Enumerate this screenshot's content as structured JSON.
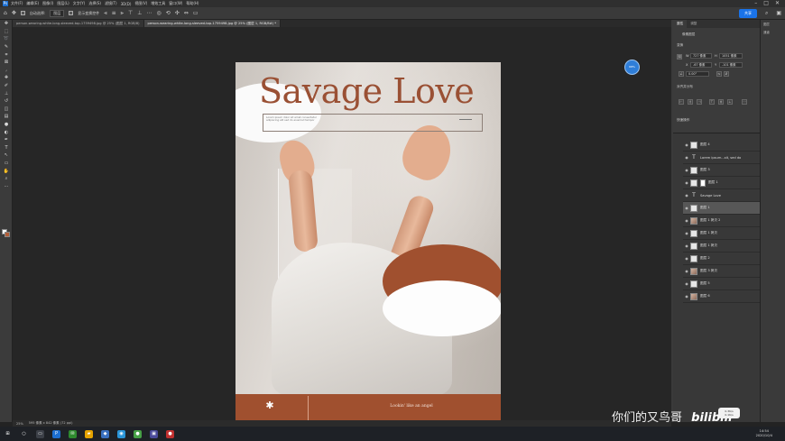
{
  "menubar": {
    "items": [
      "文件(F)",
      "编辑(E)",
      "图像(I)",
      "图层(L)",
      "文字(Y)",
      "选择(S)",
      "滤镜(T)",
      "3D(D)",
      "视图(V)",
      "增效工具",
      "窗口(W)",
      "帮助(H)"
    ],
    "ps_label": "Ps"
  },
  "options": {
    "auto_select": "自动选择:",
    "auto_select_target": "图层",
    "transform_controls": "显示变换控件",
    "share": "共享"
  },
  "tabs": [
    {
      "label": "person-wearing-white-long-sleeved-top-1759498.jpg @ 25% (图层 1, RGB/8)",
      "active": false
    },
    {
      "label": "person-wearing-white-long-sleeved-top-1759498.jpg @ 25% (图层 1, RGB/8#) *",
      "active": true
    }
  ],
  "document": {
    "title": "Savage Love",
    "subtitle_lines": [
      "Lorem ipsum dolor sit amet consectetur",
      "adipiscing elit sed do eiusmod tempor"
    ],
    "footer_star": "✱",
    "footer_text": "Lookin' like an angel"
  },
  "float_icon_label": "68%",
  "statusbar": {
    "zoom": "25%",
    "doc_info": "595 像素 x 842 像素 (72 ppi)"
  },
  "properties": {
    "tabs": [
      "属性",
      "调整"
    ],
    "section_title": "像素图层",
    "transform_label": "变换",
    "w_label": "W",
    "w_value": "727 像素",
    "h_label": "H",
    "h_value": "1051 像素",
    "x_label": "X",
    "x_value": "-67 像素",
    "y_label": "Y",
    "y_value": "-101 像素",
    "angle": "0.00°",
    "align_label": "对齐并分布",
    "quick_label": "快速操作"
  },
  "layers": [
    {
      "name": "图层 4",
      "thumb": "plain",
      "selected": false
    },
    {
      "name": "Lorem ipsum...sit, sed do",
      "thumb": "type",
      "selected": false
    },
    {
      "name": "图层 3",
      "thumb": "plain",
      "selected": false
    },
    {
      "name": "图层 1",
      "thumb": "mask",
      "selected": false
    },
    {
      "name": "Savage Love",
      "thumb": "type",
      "selected": false
    },
    {
      "name": "图层 1",
      "thumb": "plain",
      "selected": true
    },
    {
      "name": "图层 1 拷贝 2",
      "thumb": "photo",
      "selected": false
    },
    {
      "name": "图层 1 拷贝",
      "thumb": "plain",
      "selected": false
    },
    {
      "name": "图层 1 拷贝",
      "thumb": "plain",
      "selected": false
    },
    {
      "name": "图层 2",
      "thumb": "plain",
      "selected": false
    },
    {
      "name": "图层 3 拷贝",
      "thumb": "photo",
      "selected": false
    },
    {
      "name": "图层 5",
      "thumb": "plain",
      "selected": false
    },
    {
      "name": "图层 6",
      "thumb": "photo",
      "selected": false
    }
  ],
  "far_right_tabs": [
    "图层",
    "通道"
  ],
  "taskbar": {
    "time": "14:54",
    "date": "2020/10/4"
  },
  "watermark": {
    "text": "你们的又鸟哥",
    "brand": "bilibili"
  },
  "badge": {
    "line1": "0.3K/s",
    "line2": "0.1K/s"
  },
  "colors": {
    "accent_rust": "#a0502f",
    "ps_blue": "#1d6fd1"
  }
}
